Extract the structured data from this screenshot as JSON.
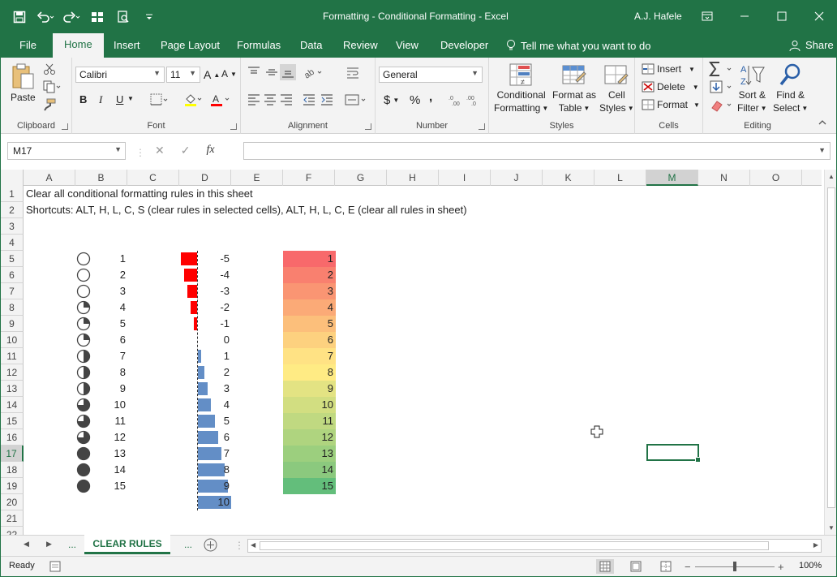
{
  "window": {
    "title": "Formatting - Conditional Formatting  -  Excel",
    "user": "A.J. Hafele"
  },
  "tabs": [
    "File",
    "Home",
    "Insert",
    "Page Layout",
    "Formulas",
    "Data",
    "Review",
    "View",
    "Developer"
  ],
  "tellme": "Tell me what you want to do",
  "share": "Share",
  "ribbon": {
    "clipboard": {
      "label": "Clipboard",
      "paste": "Paste"
    },
    "font": {
      "label": "Font",
      "name": "Calibri",
      "size": "11",
      "bold": "B",
      "italic": "I",
      "underline": "U"
    },
    "alignment": {
      "label": "Alignment"
    },
    "number": {
      "label": "Number",
      "format": "General",
      "currency": "$",
      "percent": "%",
      "comma": ","
    },
    "styles": {
      "label": "Styles",
      "cond_line1": "Conditional",
      "cond_line2": "Formatting",
      "table_line1": "Format as",
      "table_line2": "Table",
      "cell_line1": "Cell",
      "cell_line2": "Styles"
    },
    "cells": {
      "label": "Cells",
      "insert": "Insert",
      "delete": "Delete",
      "format": "Format"
    },
    "editing": {
      "label": "Editing",
      "sort_line1": "Sort &",
      "sort_line2": "Filter",
      "find_line1": "Find &",
      "find_line2": "Select"
    }
  },
  "formula_bar": {
    "name_box": "M17",
    "fx": "fx",
    "value": ""
  },
  "columns": [
    "A",
    "B",
    "C",
    "D",
    "E",
    "F",
    "G",
    "H",
    "I",
    "J",
    "K",
    "L",
    "M",
    "N",
    "O"
  ],
  "selected_column": "M",
  "selected_row": "17",
  "rows": [
    "1",
    "2",
    "3",
    "4",
    "5",
    "6",
    "7",
    "8",
    "9",
    "10",
    "11",
    "12",
    "13",
    "14",
    "15",
    "16",
    "17",
    "18",
    "19",
    "20",
    "21",
    "22"
  ],
  "sheet": {
    "a1": "Clear all conditional formatting rules in this sheet",
    "a2": "Shortcuts: ALT, H, L, C, S (clear rules in selected cells), ALT, H, L, C, E (clear all rules in sheet)",
    "icon_values": [
      "1",
      "2",
      "3",
      "4",
      "5",
      "6",
      "7",
      "8",
      "9",
      "10",
      "11",
      "12",
      "13",
      "14",
      "15"
    ],
    "icon_fill_quarters": [
      0,
      0,
      0,
      1,
      1,
      1,
      2,
      2,
      2,
      3,
      3,
      3,
      4,
      4,
      4
    ],
    "bar_values": [
      "-5",
      "-4",
      "-3",
      "-2",
      "-1",
      "0",
      "1",
      "2",
      "3",
      "4",
      "5",
      "6",
      "7",
      "8",
      "9",
      "10"
    ],
    "bar_numbers": [
      -5,
      -4,
      -3,
      -2,
      -1,
      0,
      1,
      2,
      3,
      4,
      5,
      6,
      7,
      8,
      9,
      10
    ],
    "scale_values": [
      "1",
      "2",
      "3",
      "4",
      "5",
      "6",
      "7",
      "8",
      "9",
      "10",
      "11",
      "12",
      "13",
      "14",
      "15"
    ],
    "scale_colors": [
      "#f8696b",
      "#f9806f",
      "#fa9573",
      "#fbaa77",
      "#fcbf7b",
      "#fdd17f",
      "#ffe284",
      "#ffeb84",
      "#e3e383",
      "#d2de81",
      "#c0d981",
      "#afd47f",
      "#9ccf7e",
      "#8bc97e",
      "#63be7b"
    ],
    "negative_bar_color": "#ff0000",
    "positive_bar_color": "#638ec6"
  },
  "sheet_tabs": {
    "nav_dots_left": "...",
    "active": "CLEAR RULES",
    "nav_dots_right": "..."
  },
  "status": {
    "mode": "Ready",
    "zoom": "100%"
  },
  "colors": {
    "brand": "#217346"
  }
}
